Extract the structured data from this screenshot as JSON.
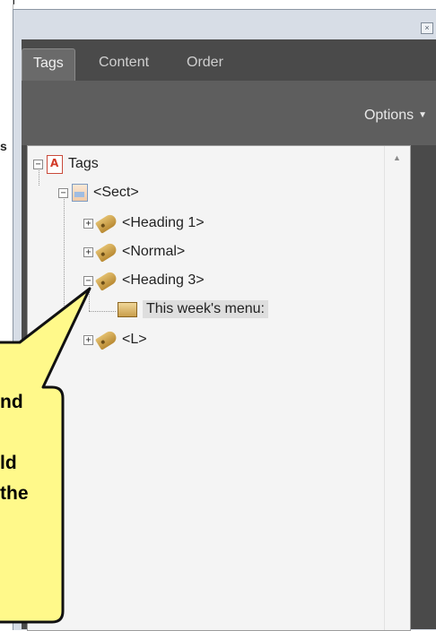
{
  "panel": {
    "tabs": [
      {
        "label": "Tags",
        "active": true
      },
      {
        "label": "Content",
        "active": false
      },
      {
        "label": "Order",
        "active": false
      }
    ],
    "options_label": "Options"
  },
  "tree": {
    "nodes": [
      {
        "label": "Tags",
        "icon": "pdf-icon",
        "expander": "minus",
        "level": 0
      },
      {
        "label": "<Sect>",
        "icon": "section-icon",
        "expander": "minus",
        "level": 1
      },
      {
        "label": "<Heading 1>",
        "icon": "tag-icon",
        "expander": "plus",
        "level": 2
      },
      {
        "label": "<Normal>",
        "icon": "tag-icon",
        "expander": "plus",
        "level": 2
      },
      {
        "label": "<Heading 3>",
        "icon": "tag-icon",
        "expander": "minus",
        "level": 2
      },
      {
        "label": "This week's menu:",
        "icon": "content-box-icon",
        "expander": "none",
        "level": 3,
        "selected": true
      },
      {
        "label": "<L>",
        "icon": "tag-icon",
        "expander": "plus",
        "level": 2
      }
    ]
  },
  "callout": {
    "lines": [
      "nd",
      "",
      "ld",
      "the"
    ],
    "fill": "#fff98a",
    "border": "#111111"
  },
  "colors": {
    "panel_dark": "#4a4a4a",
    "toolbar": "#5e5e5e",
    "tree_bg": "#f4f4f4"
  }
}
